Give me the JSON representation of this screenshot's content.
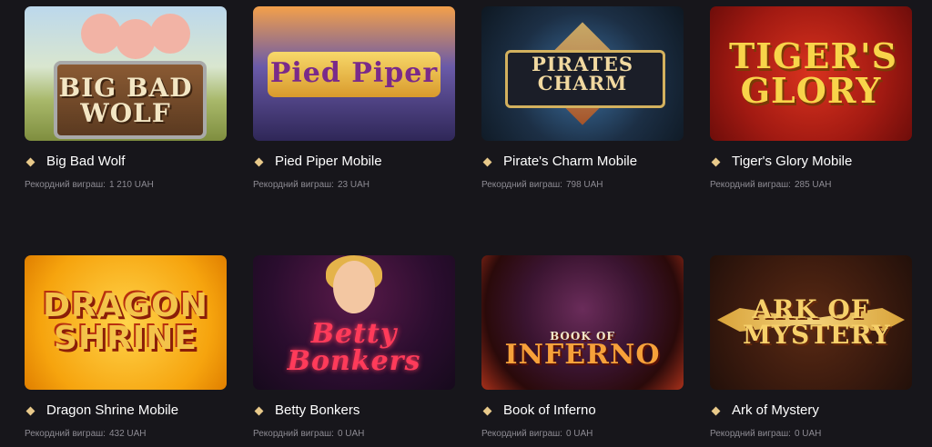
{
  "games": [
    {
      "title": "Big Bad Wolf",
      "record_label": "Рекордний виграш:",
      "record_value": "1 210 UAH",
      "logo": "BIG BAD WOLF"
    },
    {
      "title": "Pied Piper Mobile",
      "record_label": "Рекордний виграш:",
      "record_value": "23 UAH",
      "logo": "Pied Piper"
    },
    {
      "title": "Pirate's Charm Mobile",
      "record_label": "Рекордний виграш:",
      "record_value": "798 UAH",
      "logo": "PIRATES CHARM"
    },
    {
      "title": "Tiger's Glory Mobile",
      "record_label": "Рекордний виграш:",
      "record_value": "285 UAH",
      "logo": "TIGER'S GLORY"
    },
    {
      "title": "Dragon Shrine Mobile",
      "record_label": "Рекордний виграш:",
      "record_value": "432 UAH",
      "logo": "DRAGON SHRINE"
    },
    {
      "title": "Betty Bonkers",
      "record_label": "Рекордний виграш:",
      "record_value": "0 UAH",
      "logo": "Betty Bonkers"
    },
    {
      "title": "Book of Inferno",
      "record_label": "Рекордний виграш:",
      "record_value": "0 UAH",
      "logo_top": "BOOK OF",
      "logo": "INFERNO"
    },
    {
      "title": "Ark of Mystery",
      "record_label": "Рекордний виграш:",
      "record_value": "0 UAH",
      "logo": "ARK OF MYSTERY"
    }
  ],
  "colors": {
    "background": "#17161b",
    "title": "#ffffff",
    "record": "#8d8b93",
    "bullet": "#e8c98a"
  }
}
